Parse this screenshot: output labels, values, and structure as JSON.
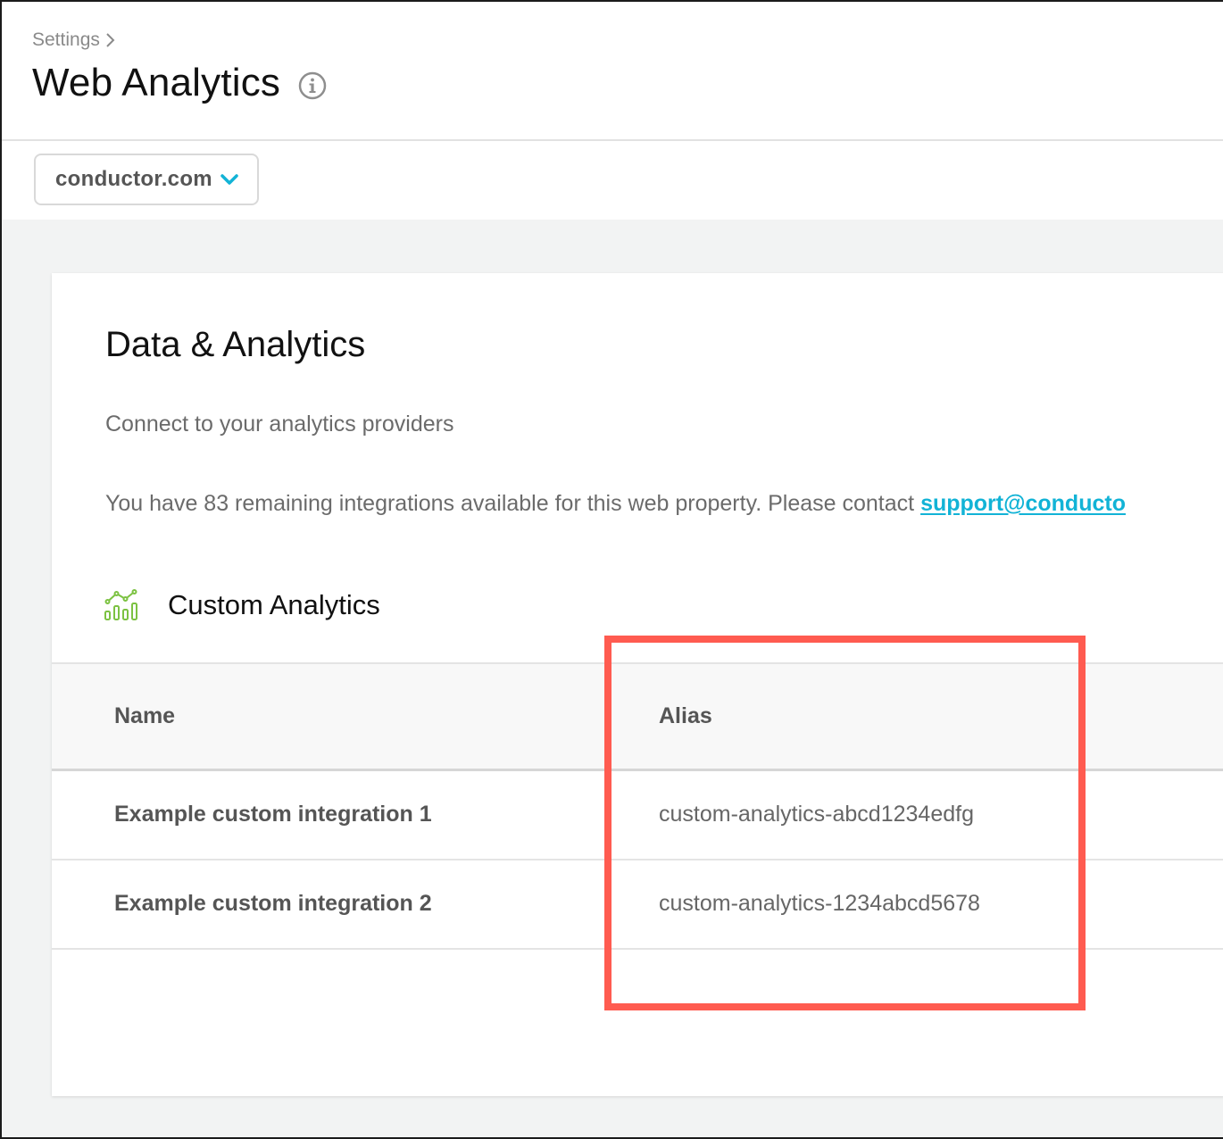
{
  "header": {
    "breadcrumb": "Settings",
    "title": "Web Analytics"
  },
  "domain_selector": {
    "value": "conductor.com"
  },
  "card": {
    "title": "Data & Analytics",
    "subtitle": "Connect to your analytics providers",
    "remaining_text": "You have 83 remaining integrations available for this web property.  Please contact ",
    "support_link": "support@conducto"
  },
  "section": {
    "title": "Custom Analytics"
  },
  "table": {
    "columns": [
      "Name",
      "Alias"
    ],
    "rows": [
      {
        "name": "Example custom integration 1",
        "alias": "custom-analytics-abcd1234edfg"
      },
      {
        "name": "Example custom integration 2",
        "alias": "custom-analytics-1234abcd5678"
      }
    ]
  },
  "colors": {
    "accent": "#12b3d6",
    "icon_green": "#7cc242",
    "highlight": "#ff5b50"
  },
  "icons": [
    "chevron-right-icon",
    "info-icon",
    "chevron-down-icon",
    "analytics-chart-icon"
  ]
}
